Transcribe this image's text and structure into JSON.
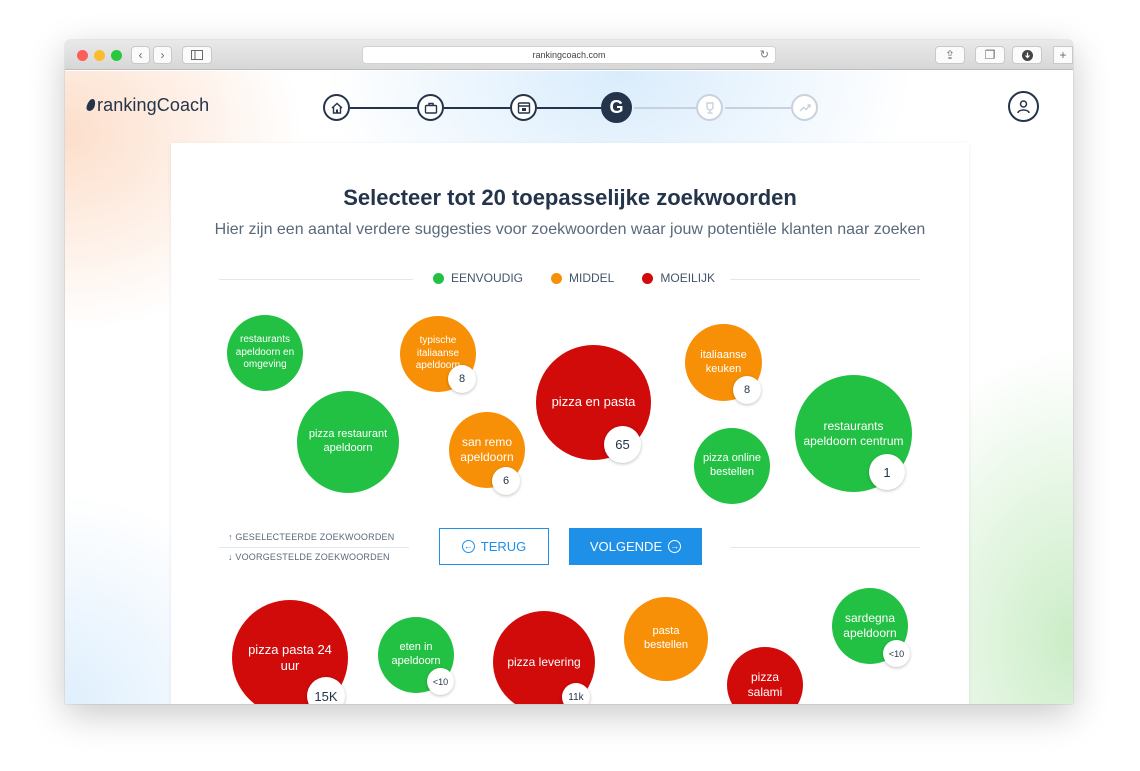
{
  "browser": {
    "url": "rankingcoach.com"
  },
  "app": {
    "logo": "rankingCoach"
  },
  "stepper": {
    "active_letter": "G"
  },
  "colors": {
    "easy": "#22c143",
    "medium": "#f79006",
    "hard": "#d10a0a",
    "primary": "#1e90e8",
    "navy": "#24344a"
  },
  "page": {
    "title": "Selecteer tot 20 toepasselijke zoekwoorden",
    "subtitle": "Hier zijn een aantal verdere suggesties voor zoekwoorden waar jouw potentiële klanten naar zoeken"
  },
  "legend": {
    "easy": "EENVOUDIG",
    "medium": "MIDDEL",
    "hard": "MOEILIJK"
  },
  "selected_keywords": [
    {
      "label": "restaurants apeldoorn en omgeving",
      "difficulty": "easy",
      "count": ""
    },
    {
      "label": "typische italiaanse apeldoorn",
      "difficulty": "medium",
      "count": "8"
    },
    {
      "label": "pizza en pasta",
      "difficulty": "hard",
      "count": "65"
    },
    {
      "label": "italiaanse keuken",
      "difficulty": "medium",
      "count": "8"
    },
    {
      "label": "pizza restaurant apeldoorn",
      "difficulty": "easy",
      "count": ""
    },
    {
      "label": "san remo apeldoorn",
      "difficulty": "medium",
      "count": "6"
    },
    {
      "label": "pizza online bestellen",
      "difficulty": "easy",
      "count": ""
    },
    {
      "label": "restaurants apeldoorn centrum",
      "difficulty": "easy",
      "count": "1"
    }
  ],
  "divider": {
    "selected_label": "↑ GESELECTEERDE ZOEKWOORDEN",
    "suggested_label": "↓ VOORGESTELDE ZOEKWOORDEN"
  },
  "buttons": {
    "back": "TERUG",
    "next": "VOLGENDE"
  },
  "suggested_keywords": [
    {
      "label": "pizza pasta 24 uur",
      "difficulty": "hard",
      "count": "15K"
    },
    {
      "label": "eten in apeldoorn",
      "difficulty": "easy",
      "count": "<10"
    },
    {
      "label": "pizza levering",
      "difficulty": "hard",
      "count": "11k"
    },
    {
      "label": "pasta bestellen",
      "difficulty": "medium",
      "count": ""
    },
    {
      "label": "pizza salami",
      "difficulty": "hard",
      "count": ""
    },
    {
      "label": "sardegna apeldoorn",
      "difficulty": "easy",
      "count": "<10"
    }
  ]
}
